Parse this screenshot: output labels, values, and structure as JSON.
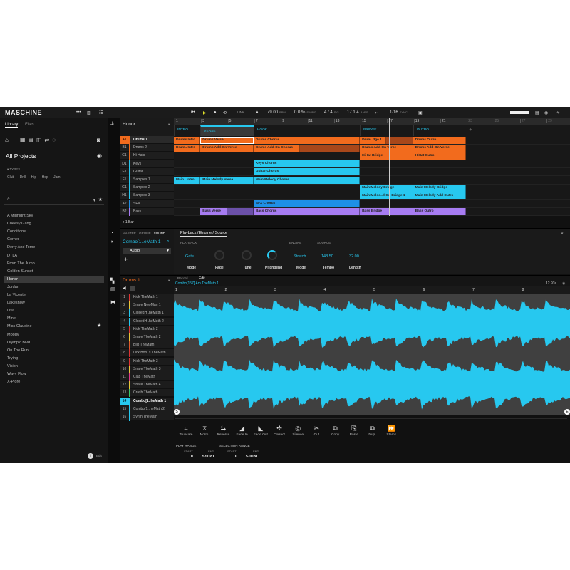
{
  "app": {
    "title": "MASCHINE"
  },
  "transport": {
    "link": "LINK",
    "tempo": "79.00",
    "tempo_unit": "BPM",
    "swing": "0.0 %",
    "swing_unit": "SWING",
    "sig": "4 / 4",
    "sig_unit": "SIG",
    "position": "17.1.4",
    "position_unit": "BARS",
    "quantize": "1/16",
    "sync": "SYNC"
  },
  "library": {
    "tabs": [
      "Library",
      "Files"
    ],
    "heading": "All Projects",
    "types_label": "TYPES",
    "types": [
      "Club",
      "Drill",
      "Hip Hop",
      "Jam"
    ],
    "search_placeholder": "",
    "edit": "Edit",
    "items": [
      "A Midnight Sky",
      "Cheesy Gang",
      "Conditions",
      "Corner",
      "Derry And Tome",
      "DTLA",
      "From The Jump",
      "Golden Sunset",
      "Honor",
      "Jordan",
      "La Vicente",
      "Lakeshow",
      "Lisa",
      "Mine",
      "Miss Claudine",
      "Moody",
      "Olympic Blvd",
      "On The Run",
      "Trying",
      "Vision",
      "Wavy Flow",
      "X-Plore"
    ],
    "selected": "Honor",
    "starred": "Miss Claudine"
  },
  "arranger": {
    "project": "Honor",
    "zoom": "1 Bar",
    "ruler": [
      "1",
      "3",
      "5",
      "7",
      "9",
      "11",
      "13",
      "15",
      "17",
      "19",
      "21",
      "23",
      "25",
      "27",
      "29"
    ],
    "sections": [
      {
        "name": "INTRO",
        "start": 1,
        "end": 3
      },
      {
        "name": "VERSE",
        "start": 3,
        "end": 7
      },
      {
        "name": "HOOK",
        "start": 7,
        "end": 15
      },
      {
        "name": "BRIDGE",
        "start": 15,
        "end": 19
      },
      {
        "name": "OUTRO",
        "start": 19,
        "end": 23
      }
    ],
    "playhead_bar": 17.2,
    "tracks": [
      {
        "id": "A1",
        "name": "Drums 1",
        "color": "#f26b1d",
        "clips": [
          [
            "Drums Intro",
            1,
            3
          ],
          [
            "Drums Verse",
            3,
            7
          ],
          [
            "Drums Chorus",
            7,
            15
          ],
          [
            "Drum..dge 1",
            15,
            17
          ],
          [
            "",
            17,
            19
          ],
          [
            "Drums Outro",
            19,
            23
          ]
        ]
      },
      {
        "id": "B1",
        "name": "Drums 2",
        "color": "#f26b1d",
        "clips": [
          [
            "Drum.. Intro",
            1,
            3
          ],
          [
            "Drums Add-On Verse",
            3,
            7
          ],
          [
            "Drums Add-On Chorus",
            7,
            10.5
          ],
          [
            "",
            10.5,
            15
          ],
          [
            "Drums Add-On Verse",
            15,
            19
          ],
          [
            "Drums Add-On Verse",
            19,
            23
          ]
        ]
      },
      {
        "id": "C1",
        "name": "Hi Hats",
        "color": "#f26b1d",
        "clips": [
          [
            "HiHat Bridge",
            15,
            19
          ],
          [
            "HiHat Outro",
            19,
            23
          ]
        ]
      },
      {
        "id": "D1",
        "name": "Keys",
        "color": "#27c8ef",
        "clips": [
          [
            "Keys Chorus",
            7,
            15
          ]
        ]
      },
      {
        "id": "E1",
        "name": "Guitar",
        "color": "#27c8ef",
        "clips": [
          [
            "Guitar Chorus",
            7,
            15
          ]
        ]
      },
      {
        "id": "F1",
        "name": "Samples 1",
        "color": "#27c8ef",
        "clips": [
          [
            "Main.. Intro",
            1,
            3
          ],
          [
            "Main Melody Verse",
            3,
            7
          ],
          [
            "Main Melody Chorus",
            7,
            15
          ]
        ]
      },
      {
        "id": "G1",
        "name": "Samples 2",
        "color": "#27c8ef",
        "clips": [
          [
            "Main Melody Bridge",
            15,
            19
          ],
          [
            "Main Melody Bridge",
            19,
            23
          ]
        ]
      },
      {
        "id": "H1",
        "name": "Samples 3",
        "color": "#27c8ef",
        "clips": [
          [
            "Main Melod..d-On Bridge 1",
            15,
            19
          ],
          [
            "Main Melody Add Outro",
            19,
            23
          ]
        ]
      },
      {
        "id": "A2",
        "name": "SFX",
        "color": "#1e90e6",
        "clips": [
          [
            "SFX Chorus",
            7,
            15
          ]
        ]
      },
      {
        "id": "B2",
        "name": "Bass",
        "color": "#a77cf2",
        "clips": [
          [
            "Bass Verse",
            3,
            5
          ],
          [
            "",
            5,
            7
          ],
          [
            "Bass Chorus",
            7,
            15
          ],
          [
            "Bass Bridge",
            15,
            19
          ],
          [
            "Bass Outro",
            19,
            23
          ]
        ]
      }
    ]
  },
  "sound": {
    "tabs": [
      "MASTER",
      "GROUP",
      "SOUND"
    ],
    "name": "Combo[1..eMath 1",
    "plugin": "Audio",
    "add": "+",
    "page_tab": "Playback / Engine / Source",
    "groups": [
      "PLAYBACK",
      "ENGINE",
      "SOURCE"
    ],
    "params": [
      {
        "label": "Mode",
        "value": "Gate",
        "type": "select"
      },
      {
        "label": "Fade",
        "type": "knob",
        "level": 0.3
      },
      {
        "label": "Tune",
        "type": "knob",
        "level": 0.5
      },
      {
        "label": "Pitchbend",
        "type": "knob",
        "level": 0.6
      },
      {
        "label": "Mode",
        "value": "Stretch",
        "type": "select"
      },
      {
        "label": "Tempo",
        "value": "148.50"
      },
      {
        "label": "Length",
        "value": "32.00"
      }
    ]
  },
  "group": {
    "name": "Drums 1",
    "pads": [
      [
        "1",
        "Kick TheMath 1",
        "#d33"
      ],
      [
        "2",
        "Snare NewMan 1",
        "#e8c53a"
      ],
      [
        "3",
        "ClosedH..heMath 1",
        "#27c8ef"
      ],
      [
        "4",
        "ClosedH..heMath 2",
        "#27c8ef"
      ],
      [
        "5",
        "Kick TheMath 2",
        "#d33"
      ],
      [
        "6",
        "Snare TheMath 2",
        "#e8c53a"
      ],
      [
        "7",
        "Blip TheMath",
        "#e05a2a"
      ],
      [
        "8",
        "Lick Bon..s TheMath",
        "#d33"
      ],
      [
        "9",
        "Kick TheMath 3",
        "#d33"
      ],
      [
        "10",
        "Snare TheMath 3",
        "#e8c53a"
      ],
      [
        "11",
        "Clap TheMath",
        "#e03a8a"
      ],
      [
        "12",
        "Snare TheMath 4",
        "#e8c53a"
      ],
      [
        "13",
        "Crash TheMath",
        "#3ac86a"
      ],
      [
        "14",
        "Combo[1..heMath 1",
        "#27c8ef"
      ],
      [
        "15",
        "Combo[1..heMath 2",
        "#27c8ef"
      ],
      [
        "16",
        "Synth TheMath",
        "#27c8ef"
      ]
    ],
    "selected": 14
  },
  "editor": {
    "tabs": [
      "Record",
      "Edit"
    ],
    "sample": "Combo[157] Am TheMath 1",
    "duration": "12.93s",
    "ruler": [
      "1",
      "2",
      "3",
      "4",
      "5",
      "6",
      "7",
      "8"
    ],
    "tools": [
      [
        "Truncate",
        "⌗"
      ],
      [
        "Norm.",
        "⧖"
      ],
      [
        "Reverse",
        "⇆"
      ],
      [
        "Fade In",
        "◢"
      ],
      [
        "Fade Out",
        "◣"
      ],
      [
        "Correct",
        "✣"
      ],
      [
        "Silence",
        "◎"
      ],
      [
        "Cut",
        "✂"
      ],
      [
        "Copy",
        "⧉"
      ],
      [
        "Paste",
        "⎘"
      ],
      [
        "Dupl.",
        "⧉"
      ],
      [
        "Stems",
        "⏩"
      ]
    ],
    "play_range": {
      "label": "PLAY RANGE",
      "start_label": "START",
      "end_label": "END",
      "start": "0",
      "end": "570181"
    },
    "selection_range": {
      "label": "SELECTION RANGE",
      "start_label": "START",
      "end_label": "END",
      "start": "0",
      "end": "570181"
    }
  },
  "colors": {
    "accent": "#27c8ef",
    "orange": "#f26b1d",
    "purple": "#a77cf2",
    "sfx": "#1e90e6"
  }
}
